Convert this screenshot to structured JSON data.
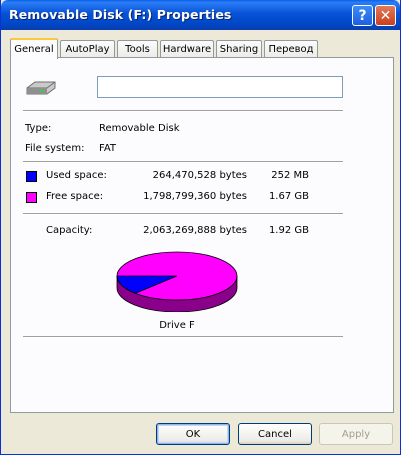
{
  "window": {
    "title": "Removable Disk (F:) Properties",
    "help_glyph": "?",
    "close_glyph": "✕"
  },
  "tabs": [
    {
      "label": "General",
      "active": true
    },
    {
      "label": "AutoPlay"
    },
    {
      "label": "Tools"
    },
    {
      "label": "Hardware"
    },
    {
      "label": "Sharing"
    },
    {
      "label": "Перевод"
    }
  ],
  "general": {
    "volume_label_value": "",
    "type_label": "Type:",
    "type_value": "Removable Disk",
    "fs_label": "File system:",
    "fs_value": "FAT",
    "used_label": "Used space:",
    "used_bytes": "264,470,528 bytes",
    "used_size": "252 MB",
    "free_label": "Free space:",
    "free_bytes": "1,798,799,360 bytes",
    "free_size": "1.67 GB",
    "capacity_label": "Capacity:",
    "capacity_bytes": "2,063,269,888 bytes",
    "capacity_size": "1.92 GB",
    "drive_label": "Drive F",
    "used_fraction": 0.128,
    "colors": {
      "used": "#0000ff",
      "free": "#ff00ff"
    }
  },
  "buttons": {
    "ok": "OK",
    "cancel": "Cancel",
    "apply": "Apply"
  }
}
